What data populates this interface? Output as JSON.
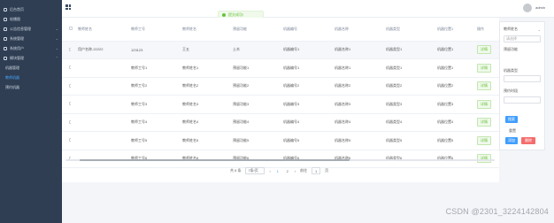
{
  "sidebar": {
    "items": [
      {
        "label": "后台首页",
        "icon": "home-icon"
      },
      {
        "label": "轮播图",
        "icon": "image-icon"
      },
      {
        "label": "公告信息管理",
        "icon": "notice-icon"
      },
      {
        "label": "系统管理",
        "icon": "gear-icon"
      },
      {
        "label": "系统用户",
        "icon": "user-icon"
      },
      {
        "label": "模块管理",
        "icon": "module-icon"
      }
    ],
    "sub_items": [
      {
        "label": "机器管理"
      },
      {
        "label": "教师机器"
      },
      {
        "label": "预约机器"
      }
    ]
  },
  "header": {
    "user_name": "admin"
  },
  "toast": {
    "text": "提交成功!"
  },
  "table": {
    "columns": [
      "教师姓名",
      "教师工号",
      "教师姓名",
      "预留功能",
      "机器编号",
      "机器名称",
      "机器类型",
      "机器位置1",
      "操作"
    ],
    "rows": [
      [
        "用户名称-22222",
        "123123",
        "王五",
        "土木",
        "机器编号1",
        "机器名称1",
        "机器类型1",
        "机器位置1",
        "详情"
      ],
      [
        "",
        "教师工号1",
        "教师姓名1",
        "预留功能1",
        "机器编号1",
        "机器名称1",
        "机器类型1",
        "机器位置1",
        "详情"
      ],
      [
        "",
        "教师工号2",
        "教师姓名2",
        "预留功能2",
        "机器编号2",
        "机器名称2",
        "机器类型2",
        "机器位置2",
        "详情"
      ],
      [
        "",
        "教师工号3",
        "教师姓名3",
        "预留功能3",
        "机器编号3",
        "机器名称3",
        "机器类型3",
        "机器位置3",
        "详情"
      ],
      [
        "",
        "教师工号4",
        "教师姓名4",
        "预留功能4",
        "机器编号4",
        "机器名称4",
        "机器类型4",
        "机器位置4",
        "详情"
      ],
      [
        "",
        "教师工号5",
        "教师姓名5",
        "预留功能5",
        "机器编号5",
        "机器名称5",
        "机器类型5",
        "机器位置5",
        "详情"
      ],
      [
        "",
        "教师工号6",
        "教师姓名6",
        "预留功能6",
        "机器编号6",
        "机器名称6",
        "机器类型6",
        "机器位置6",
        "详情"
      ]
    ]
  },
  "pagination": {
    "total": "共 6 条",
    "page_size": "7条/页",
    "prev": "‹",
    "pages": [
      "1",
      "2"
    ],
    "next": "›",
    "goto_label": "前往",
    "goto_value": "1",
    "goto_suffix": "页"
  },
  "right_panel": {
    "select_label": "教师姓名",
    "select_placeholder": "请选择",
    "label_1": "预留功能",
    "label_2": "机器类型",
    "label_3": "预约时段",
    "search_btn": "搜索",
    "reset_btn": "重置",
    "add_btn": "添加",
    "delete_btn": "删除"
  },
  "watermark": "CSDN @2301_3224142804"
}
